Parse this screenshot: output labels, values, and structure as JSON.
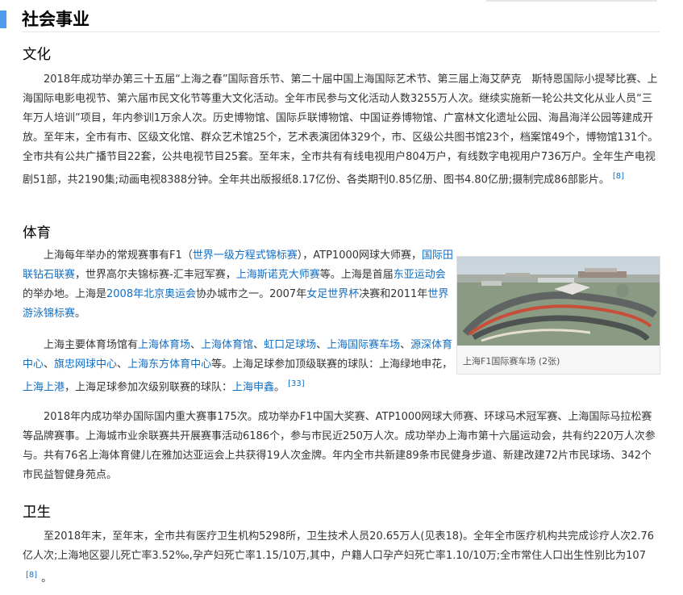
{
  "section": {
    "title": "社会事业"
  },
  "culture": {
    "heading": "文化",
    "text": "2018年成功举办第三十五届“上海之春”国际音乐节、第二十届中国上海国际艺术节、第三届上海艾萨克　斯特恩国际小提琴比赛、上海国际电影电视节、第六届市民文化节等重大文化活动。全年市民参与文化活动人数3255万人次。继续实施新一轮公共文化从业人员“三年万人培训”项目，年内参训1万余人次。历史博物馆、国际乒联博物馆、中国证券博物馆、广富林文化遗址公园、海昌海洋公园等建成开放。至年末，全市有市、区级文化馆、群众艺术馆25个，艺术表演团体329个，市、区级公共图书馆23个，档案馆49个，博物馆131个。全市共有公共广播节目22套，公共电视节目25套。至年末，全市共有有线电视用户804万户，有线数字电视用户736万户。全年生产电视剧51部，共2190集;动画电视8388分钟。全年共出版报纸8.17亿份、各类期刊0.85亿册、图书4.80亿册;摄制完成86部影片。",
    "ref": "[8]"
  },
  "sports": {
    "heading": "体育",
    "p1": {
      "t1": "上海每年举办的常规赛事有F1（",
      "l1": "世界一级方程式锦标赛",
      "t2": "），ATP1000网球大师赛，",
      "l2": "国际田联钻石联赛",
      "t3": "，世界高尔夫锦标赛-汇丰冠军赛，",
      "l3": "上海斯诺克大师赛",
      "t4": "等。上海是首届",
      "l4": "东亚运动会",
      "t5": "的举办地。上海是",
      "l5": "2008年北京奥运会",
      "t6": "协办城市之一。2007年",
      "l6": "女足世界杯",
      "t7": "决赛和2011年",
      "l7": "世界游泳锦标赛",
      "t8": "。"
    },
    "p2": {
      "t1": "上海主要体育场馆有",
      "l1": "上海体育场",
      "s1": "、",
      "l2": "上海体育馆",
      "s2": "、",
      "l3": "虹口足球场",
      "s3": "、",
      "l4": "上海国际赛车场",
      "s4": "、",
      "l5": "源深体育中心",
      "s5": "、",
      "l6": "旗忠网球中心",
      "s6": "、",
      "l7": "上海东方体育中心",
      "t2": "等。上海足球参加顶级联赛的球队：上海绿地申花，",
      "l8": "上海上港",
      "t3": "，上海足球参加次级别联赛的球队：",
      "l9": "上海申鑫",
      "t4": "。",
      "ref": "[33]"
    },
    "p3": "2018年内成功举办国际国内重大赛事175次。成功举办F1中国大奖赛、ATP1000网球大师赛、环球马术冠军赛、上海国际马拉松赛等品牌赛事。上海城市业余联赛共开展赛事活动6186个，参与市民近250万人次。成功举办上海市第十六届运动会，共有约220万人次参与。共有76名上海体育健儿在雅加达亚运会上共获得19人次金牌。年内全市共新建89条市民健身步道、新建改建72片市民球场、342个市民益智健身苑点。",
    "figure_caption": "上海F1国际赛车场 (2张)"
  },
  "health": {
    "heading": "卫生",
    "text": "至2018年末，至年末，全市共有医疗卫生机构5298所，卫生技术人员20.65万人(见表18)。全年全市医疗机构共完成诊疗人次2.76亿人次;上海地区婴儿死亡率3.52‰,孕产妇死亡率1.15/10万,其中，户籍人口孕产妇死亡率1.10/10万;全市常住人口出生性别比为107",
    "ref": "[8]",
    "tail": "。"
  },
  "colors": {
    "accent": "#4f9cee",
    "link": "#136ec2",
    "text": "#333333"
  }
}
